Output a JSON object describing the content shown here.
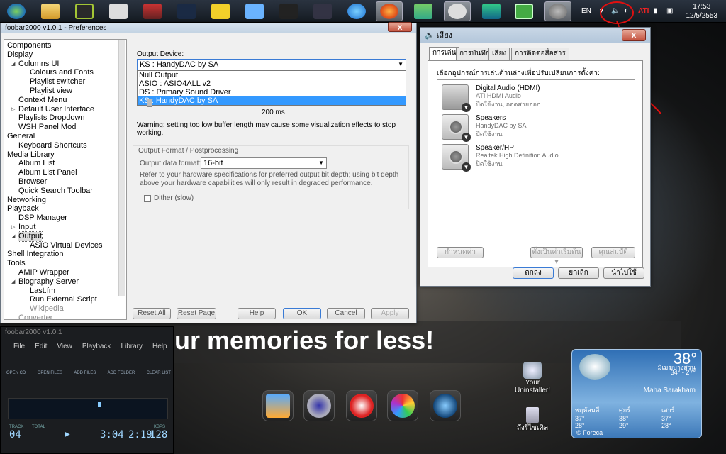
{
  "taskbar": {
    "tray_lang": "EN",
    "tray_ati": "ATI",
    "clock_time": "17:53",
    "clock_date": "12/5/2553"
  },
  "prefs": {
    "title": "foobar2000 v1.0.1 - Preferences",
    "tree": [
      {
        "label": "Components",
        "depth": 0
      },
      {
        "label": "Display",
        "depth": 0,
        "expand": "◢"
      },
      {
        "label": "Columns UI",
        "depth": 1,
        "expand": "◢"
      },
      {
        "label": "Colours and Fonts",
        "depth": 2
      },
      {
        "label": "Playlist switcher",
        "depth": 2
      },
      {
        "label": "Playlist view",
        "depth": 2
      },
      {
        "label": "Context Menu",
        "depth": 1
      },
      {
        "label": "Default User Interface",
        "depth": 1,
        "expand": "▷"
      },
      {
        "label": "Playlists Dropdown",
        "depth": 1
      },
      {
        "label": "WSH Panel Mod",
        "depth": 1
      },
      {
        "label": "General",
        "depth": 0,
        "expand": "◢"
      },
      {
        "label": "Keyboard Shortcuts",
        "depth": 1
      },
      {
        "label": "Media Library",
        "depth": 0,
        "expand": "◢"
      },
      {
        "label": "Album List",
        "depth": 1
      },
      {
        "label": "Album List Panel",
        "depth": 1
      },
      {
        "label": "Browser",
        "depth": 1
      },
      {
        "label": "Quick Search Toolbar",
        "depth": 1
      },
      {
        "label": "Networking",
        "depth": 0
      },
      {
        "label": "Playback",
        "depth": 0,
        "expand": "◢"
      },
      {
        "label": "DSP Manager",
        "depth": 1
      },
      {
        "label": "Input",
        "depth": 1,
        "expand": "▷"
      },
      {
        "label": "Output",
        "depth": 1,
        "expand": "◢",
        "selected": true
      },
      {
        "label": "ASIO Virtual Devices",
        "depth": 2
      },
      {
        "label": "Shell Integration",
        "depth": 0
      },
      {
        "label": "Tools",
        "depth": 0,
        "expand": "◢"
      },
      {
        "label": "AMIP Wrapper",
        "depth": 1
      },
      {
        "label": "Biography Server",
        "depth": 1,
        "expand": "◢"
      },
      {
        "label": "Last.fm",
        "depth": 2
      },
      {
        "label": "Run External Script",
        "depth": 2
      },
      {
        "label": "Wikipedia",
        "depth": 2
      },
      {
        "label": "Converter",
        "depth": 1
      }
    ],
    "output_device_label": "Output Device:",
    "output_device_value": "KS : HandyDAC by SA",
    "device_options": [
      "Null Output",
      "ASIO : ASIO4ALL v2",
      "DS : Primary Sound Driver",
      "KS : HandyDAC by SA"
    ],
    "buffer_value": "200 ms",
    "warning": "Warning: setting too low buffer length may cause some visualization effects to stop working.",
    "format_group": "Output Format / Postprocessing",
    "format_label": "Output data format:",
    "format_value": "16-bit",
    "format_hint": "Refer to your hardware specifications for preferred output bit depth; using bit depth above your hardware capabilities will only result in degraded performance.",
    "dither_label": "Dither (slow)",
    "buttons": {
      "reset_all": "Reset All",
      "reset_page": "Reset Page",
      "help": "Help",
      "ok": "OK",
      "cancel": "Cancel",
      "apply": "Apply"
    }
  },
  "sound": {
    "title": "เสียง",
    "close": "x",
    "tabs": [
      "การเล่น",
      "การบันทึก",
      "เสียง",
      "การติดต่อสื่อสาร"
    ],
    "instruction": "เลือกอุปกรณ์การเล่นด้านล่างเพื่อปรับเปลี่ยนการตั้งค่า:",
    "devices": [
      {
        "name": "Digital Audio (HDMI)",
        "line1": "ATI HDMI Audio",
        "line2": "ปิดใช้งาน, ถอดสายออก"
      },
      {
        "name": "Speakers",
        "line1": "HandyDAC by SA",
        "line2": "ปิดใช้งาน"
      },
      {
        "name": "Speaker/HP",
        "line1": "Realtek High Definition Audio",
        "line2": "ปิดใช้งาน"
      }
    ],
    "configure": "กำหนดค่า",
    "set_default": "ตั้งเป็นค่าเริ่มต้น",
    "properties": "คุณสมบัติ",
    "ok": "ตกลง",
    "cancel": "ยกเลิก",
    "apply": "นำไปใช้"
  },
  "banner": "more of your memories for less!",
  "player": {
    "title": "foobar2000 v1.0.1",
    "menu": [
      "File",
      "Edit",
      "View",
      "Playback",
      "Library",
      "Help"
    ],
    "buttons": [
      "OPEN CD",
      "OPEN FILES",
      "ADD FILES",
      "ADD FOLDER",
      "CLEAR LIST"
    ],
    "labels": {
      "track": "TRACK",
      "total": "TOTAL",
      "kbps": "KBPS"
    },
    "track": "04",
    "elapsed": "3:04",
    "total": "2:19",
    "bitrate": "128"
  },
  "desktop": {
    "uninstaller": "Your Uninstaller!",
    "recycle": "ถังรีไซเคิล"
  },
  "weather": {
    "temp": "38°",
    "range": "34° - 27°",
    "condition": "มีเมฆบางส่วน",
    "city": "Maha Sarakham",
    "days": [
      {
        "day": "พฤหัสบดี",
        "hi": "37°",
        "lo": "28°"
      },
      {
        "day": "ศุกร์",
        "hi": "38°",
        "lo": "29°"
      },
      {
        "day": "เสาร์",
        "hi": "37°",
        "lo": "28°"
      }
    ],
    "source": "© Foreca"
  },
  "colors": {
    "selection": "#3399ff",
    "annotation": "#e01010",
    "title_bar": "#b3c6da"
  }
}
